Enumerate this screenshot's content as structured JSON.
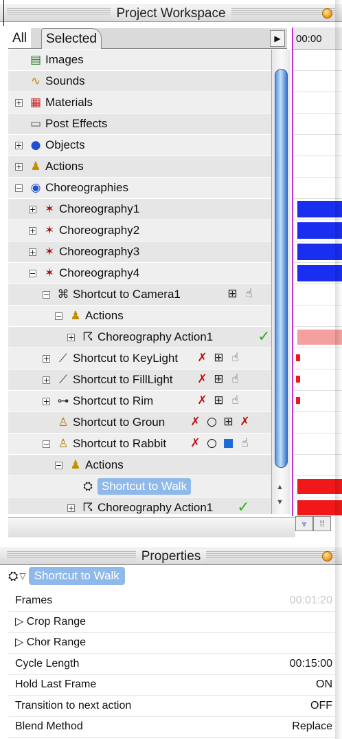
{
  "workspace": {
    "title": "Project Workspace",
    "tabs": [
      "All",
      "Selected"
    ],
    "timeline_time": "00:00",
    "tree": [
      {
        "label": "Images",
        "icon": "images-icon",
        "indent": 0,
        "expander": "",
        "alt": false
      },
      {
        "label": "Sounds",
        "icon": "sounds-icon",
        "indent": 0,
        "expander": "",
        "alt": true
      },
      {
        "label": "Materials",
        "icon": "materials-icon",
        "indent": 0,
        "expander": "+",
        "alt": false
      },
      {
        "label": "Post Effects",
        "icon": "post-effects-icon",
        "indent": 0,
        "expander": "",
        "alt": true
      },
      {
        "label": "Objects",
        "icon": "objects-icon",
        "indent": 0,
        "expander": "+",
        "alt": false
      },
      {
        "label": "Actions",
        "icon": "actions-icon",
        "indent": 0,
        "expander": "+",
        "alt": true
      },
      {
        "label": "Choreographies",
        "icon": "choreographies-icon",
        "indent": 0,
        "expander": "−",
        "alt": false
      },
      {
        "label": "Choreography1",
        "icon": "choreography-icon",
        "indent": 1,
        "expander": "+",
        "alt": true
      },
      {
        "label": "Choreography2",
        "icon": "choreography-icon",
        "indent": 1,
        "expander": "+",
        "alt": false
      },
      {
        "label": "Choreography3",
        "icon": "choreography-icon",
        "indent": 1,
        "expander": "+",
        "alt": true
      },
      {
        "label": "Choreography4",
        "icon": "choreography-icon",
        "indent": 1,
        "expander": "−",
        "alt": false
      },
      {
        "label": "Shortcut to Camera1",
        "icon": "camera-shortcut-icon",
        "indent": 2,
        "expander": "−",
        "alt": true
      },
      {
        "label": "Actions",
        "icon": "actions-icon",
        "indent": 3,
        "expander": "−",
        "alt": false
      },
      {
        "label": "Choreography Action1",
        "icon": "running-figure-icon",
        "indent": 4,
        "expander": "+",
        "alt": true
      },
      {
        "label": "Shortcut to KeyLight",
        "icon": "light-shortcut-icon",
        "indent": 2,
        "expander": "+",
        "alt": false
      },
      {
        "label": "Shortcut to FillLight",
        "icon": "light-shortcut-icon",
        "indent": 2,
        "expander": "+",
        "alt": true
      },
      {
        "label": "Shortcut to Rim",
        "icon": "rim-light-shortcut-icon",
        "indent": 2,
        "expander": "+",
        "alt": false
      },
      {
        "label": "Shortcut to Groun",
        "icon": "model-shortcut-icon",
        "indent": 2,
        "expander": "",
        "alt": true
      },
      {
        "label": "Shortcut to Rabbit",
        "icon": "model-shortcut-icon",
        "indent": 2,
        "expander": "−",
        "alt": false
      },
      {
        "label": "Actions",
        "icon": "actions-icon",
        "indent": 3,
        "expander": "−",
        "alt": true
      },
      {
        "label": "Shortcut to Walk",
        "icon": "action-shortcut-icon",
        "indent": 4,
        "expander": "",
        "alt": false,
        "selected": true
      },
      {
        "label": "Choreography Action1",
        "icon": "running-figure-icon",
        "indent": 4,
        "expander": "+",
        "alt": true
      }
    ]
  },
  "properties": {
    "title": "Properties",
    "selected_name": "Shortcut to Walk",
    "rows": [
      {
        "label": "Frames",
        "value": "00:01:20",
        "muted": true
      },
      {
        "label": "▷ Crop Range",
        "value": ""
      },
      {
        "label": "▷ Chor Range",
        "value": ""
      },
      {
        "label": "Cycle Length",
        "value": "00:15:00"
      },
      {
        "label": "Hold Last Frame",
        "value": "ON"
      },
      {
        "label": "Transition to next action",
        "value": "OFF"
      },
      {
        "label": "Blend Method",
        "value": "Replace"
      }
    ]
  },
  "colors": {
    "selection": "#8fb9ea",
    "blue_bar": "#1a2ef0",
    "red_bar": "#f01818",
    "pink_bar": "#f4a0a0",
    "scroll_thumb": "#5a8fd8",
    "check": "#32b020"
  }
}
